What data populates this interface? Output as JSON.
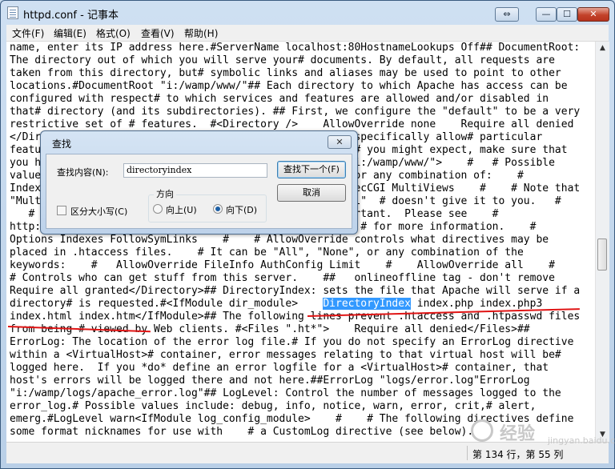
{
  "window": {
    "title": "httpd.conf - 记事本",
    "controls": {
      "restore_icon": "⇔",
      "minimize_icon": "—",
      "maximize_icon": "☐",
      "close_icon": "✕"
    }
  },
  "menu": {
    "items": [
      "文件(F)",
      "编辑(E)",
      "格式(O)",
      "查看(V)",
      "帮助(H)"
    ]
  },
  "editor": {
    "lines": [
      "name, enter its IP address here.#ServerName localhost:80HostnameLookups Off## DocumentRoot:",
      "The directory out of which you will serve your# documents. By default, all requests are",
      "taken from this directory, but# symbolic links and aliases may be used to point to other",
      "locations.#DocumentRoot \"i:/wamp/www/\"## Each directory to which Apache has access can be",
      "configured with respect# to which services and features are allowed and/or disabled in",
      "that# directory (and its subdirectories). ## First, we configure the \"default\" to be a very",
      "restrictive set of # features.  #<Directory />    AllowOverride none    Require all denied",
      "</Directory>##                                      st specifically allow# particular",
      "features to be enabled - so if something's not workiyas# you might expect, make sure that",
      "you have specifically enabled it# below.## <Directory \"i:/wamp/www/\">    #   # Possible",
      "values for the Options directive are \"None\", \"All\",  # or any combination of:    #",
      "Indexes Includes FollowSymLinks SymLinksifOwnerMatch ExecCGI MultiViews    #    # Note that",
      "\"MultiViews\" must be named *explicitly* --- \"Options All\"  # doesn't give it to you.   #",
      "   # The Options directive is both complicated and important.  Please see    #",
      "http://httpd.apache.org/docs/2.4/mod/core.html#options  # for more information.    #",
      "Options Indexes FollowSymLinks    #    # AllowOverride controls what directives may be",
      "placed in .htaccess files.    # It can be \"All\", \"None\", or any combination of the",
      "keywords:    #   AllowOverride FileInfo AuthConfig Limit    #    AllowOverride all    #",
      "# Controls who can get stuff from this server.    ##   onlineoffline tag - don't remove",
      "Require all granted</Directory>## DirectoryIndex: sets the file that Apache will serve if a",
      "directory# is requested.#<IfModule dir_module>    ",
      "index.html index.htm</IfModule>## The following lines prevent .htaccess and .htpasswd files",
      "from being # viewed by Web clients. #<Files \".ht*\">    Require all denied</Files>##",
      "ErrorLog: The location of the error log file.# If you do not specify an ErrorLog directive",
      "within a <VirtualHost># container, error messages relating to that virtual host will be#",
      "logged here.  If you *do* define an error logfile for a <VirtualHost># container, that",
      "host's errors will be logged there and not here.##ErrorLog \"logs/error.log\"ErrorLog",
      "\"i:/wamp/logs/apache_error.log\"## LogLevel: Control the number of messages logged to the",
      "error_log.# Possible values include: debug, info, notice, warn, error, crit,# alert,",
      "emerg.#LogLevel warn<IfModule log_config_module>    #    # The following directives define",
      "some format nicknames for use with    # a CustomLog directive (see below)."
    ],
    "selected_word": "DirectoryIndex",
    "after_selection": " index.php index.php3"
  },
  "find_dialog": {
    "title": "查找",
    "find_label": "查找内容(N):",
    "find_value": "directoryindex",
    "find_next_button": "查找下一个(F)",
    "cancel_button": "取消",
    "direction_label": "方向",
    "up_label": "向上(U)",
    "down_label": "向下(D)",
    "match_case_label": "区分大小写(C)",
    "direction_selected": "down",
    "match_case_checked": false,
    "close_icon": "✕"
  },
  "scrollbar": {
    "up_icon": "▲",
    "down_icon": "▼"
  },
  "statusbar": {
    "position": "第 134 行，第 55 列"
  },
  "watermark": {
    "text": "经验",
    "sub": "jingyan.baidu.com"
  },
  "colors": {
    "selection": "#3399ff",
    "underline": "#e01515"
  }
}
